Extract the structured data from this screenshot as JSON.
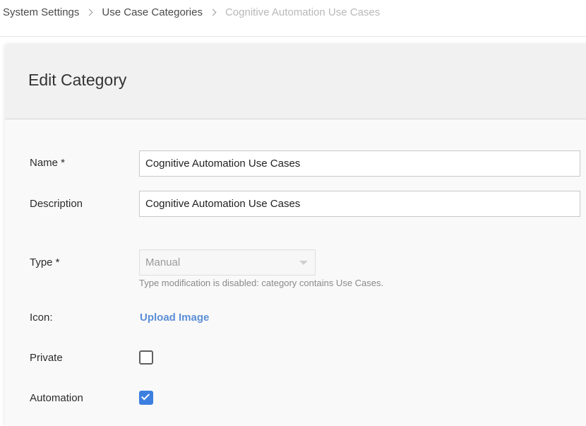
{
  "breadcrumb": {
    "items": [
      "System Settings",
      "Use Case Categories",
      "Cognitive Automation Use Cases"
    ]
  },
  "panel": {
    "title": "Edit Category"
  },
  "form": {
    "name": {
      "label": "Name *",
      "value": "Cognitive Automation Use Cases"
    },
    "description": {
      "label": "Description",
      "value": "Cognitive Automation Use Cases"
    },
    "type": {
      "label": "Type *",
      "selected": "Manual",
      "disabled": true,
      "helper": "Type modification is disabled: category contains Use Cases."
    },
    "icon": {
      "label": "Icon:",
      "upload_label": "Upload Image"
    },
    "private": {
      "label": "Private",
      "checked": false
    },
    "automation": {
      "label": "Automation",
      "checked": true
    }
  },
  "colors": {
    "accent": "#3d7fe0",
    "link": "#5b8fd6"
  }
}
